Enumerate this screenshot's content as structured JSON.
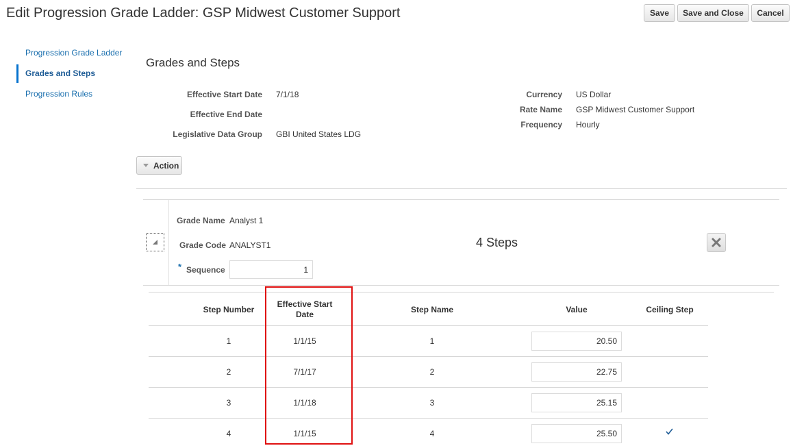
{
  "header": {
    "title": "Edit Progression Grade Ladder: GSP Midwest Customer Support",
    "save_label": "Save",
    "save_close_label": "Save and Close",
    "cancel_label": "Cancel"
  },
  "sidebar": {
    "items": [
      {
        "label": "Progression Grade Ladder",
        "active": false
      },
      {
        "label": "Grades and Steps",
        "active": true
      },
      {
        "label": "Progression Rules",
        "active": false
      }
    ]
  },
  "main": {
    "section_title": "Grades and Steps",
    "fields": {
      "effective_start_date": {
        "label": "Effective Start Date",
        "value": "7/1/18"
      },
      "effective_end_date": {
        "label": "Effective End Date",
        "value": ""
      },
      "legislative_data_group": {
        "label": "Legislative Data Group",
        "value": "GBI United States LDG"
      },
      "currency": {
        "label": "Currency",
        "value": "US Dollar"
      },
      "rate_name": {
        "label": "Rate Name",
        "value": "GSP Midwest Customer Support"
      },
      "frequency": {
        "label": "Frequency",
        "value": "Hourly"
      }
    },
    "action_label": "Action"
  },
  "grade": {
    "grade_name_label": "Grade Name",
    "grade_name": "Analyst 1",
    "grade_code_label": "Grade Code",
    "grade_code": "ANALYST1",
    "sequence_required_mark": "*",
    "sequence_label": "Sequence",
    "sequence_value": "1",
    "steps_count_label": "4 Steps"
  },
  "steps_table": {
    "columns": [
      "Step Number",
      "Effective Start Date",
      "Step Name",
      "Value",
      "Ceiling Step"
    ],
    "rows": [
      {
        "step_number": "1",
        "effective_start_date": "1/1/15",
        "step_name": "1",
        "value": "20.50",
        "ceiling_step": false
      },
      {
        "step_number": "2",
        "effective_start_date": "7/1/17",
        "step_name": "2",
        "value": "22.75",
        "ceiling_step": false
      },
      {
        "step_number": "3",
        "effective_start_date": "1/1/18",
        "step_name": "3",
        "value": "25.15",
        "ceiling_step": false
      },
      {
        "step_number": "4",
        "effective_start_date": "1/1/15",
        "step_name": "4",
        "value": "25.50",
        "ceiling_step": true
      }
    ]
  },
  "colors": {
    "link": "#1a6fae",
    "active_nav_indicator": "#0572ce",
    "highlight_border": "#e01010",
    "check": "#1e5c96"
  },
  "icons": {
    "action_menu": "chevron-down-icon",
    "collapse": "collapse-triangle-icon",
    "delete": "close-icon",
    "ceiling": "checkmark-icon"
  }
}
